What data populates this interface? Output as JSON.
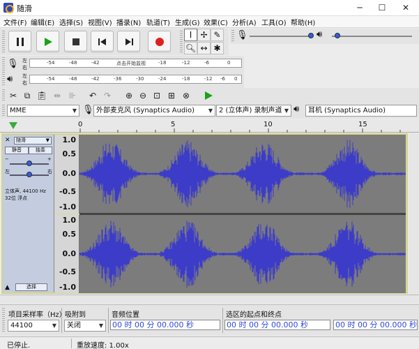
{
  "window": {
    "title": "随滑",
    "minimize": "─",
    "maximize": "☐",
    "close": "✕"
  },
  "menu": [
    "文件(F)",
    "编辑(E)",
    "选择(S)",
    "视图(V)",
    "播录(N)",
    "轨道(T)",
    "生成(G)",
    "效果(C)",
    "分析(A)",
    "工具(O)",
    "帮助(H)"
  ],
  "meter": {
    "record_ticks": [
      "-54",
      "-48",
      "-42",
      "点击开始监视",
      "-18",
      "-12",
      "-6",
      "0"
    ],
    "play_ticks": [
      "-54",
      "-48",
      "-42",
      "-36",
      "-30",
      "-24",
      "-18",
      "-12",
      "-6",
      "0"
    ],
    "left": "左",
    "right": "右"
  },
  "device": {
    "host": "MME",
    "input": "外部麦克风 (Synaptics Audio)",
    "channels": "2 (立体声) 录制声道",
    "output": "耳机 (Synaptics Audio)"
  },
  "ruler": {
    "ticks": [
      "0",
      "5",
      "10",
      "15"
    ]
  },
  "track": {
    "name": "随滑",
    "mute": "静音",
    "solo": "独奏",
    "info_line1": "立体声, 44100 Hz",
    "info_line2": "32位 浮点",
    "select": "选择",
    "scale": [
      "1.0",
      "0.5",
      "0.0",
      "-0.5",
      "-1.0"
    ]
  },
  "bottom": {
    "rate_label": "项目采样率（Hz）",
    "rate_value": "44100",
    "snap_label": "吸附到",
    "snap_value": "关闭",
    "pos_label": "音频位置",
    "pos_value": "00 时 00 分 00.000 秒",
    "sel_label": "选区的起点和终点",
    "sel_start": "00 时 00 分 00.000 秒",
    "sel_end": "00 时 00 分 00.000 秒"
  },
  "status": {
    "state": "已停止.",
    "speed": "重放速度: 1.00x"
  },
  "colors": {
    "waveform": "#3c3cc8",
    "waveform_bg": "#7c7c7c",
    "track_border": "#d4d486",
    "record": "#e02020",
    "play": "#19a319"
  }
}
